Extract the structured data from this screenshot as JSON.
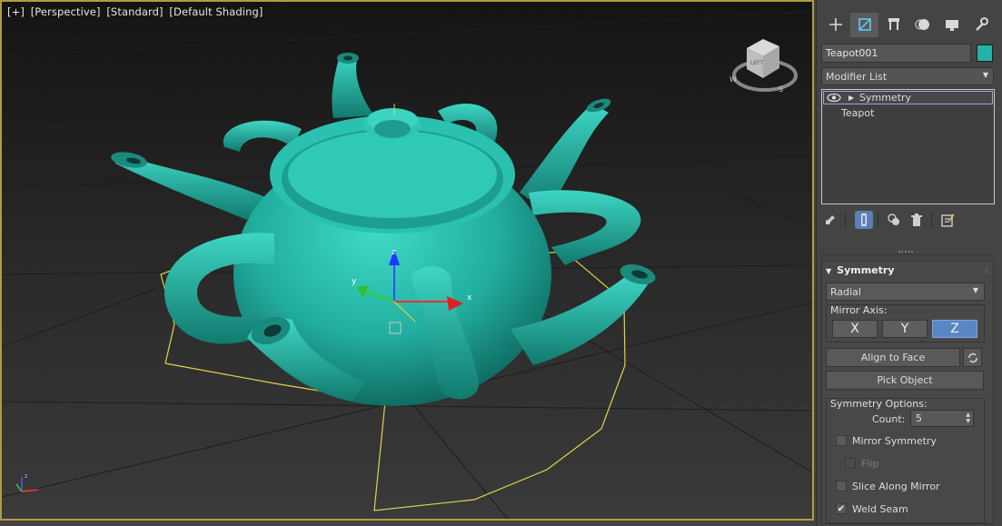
{
  "viewport": {
    "labels": [
      "[+]",
      "[Perspective]",
      "[Standard]",
      "[Default Shading]"
    ],
    "viewcube_face": "LEFT",
    "compass": {
      "w": "W",
      "s": "S"
    },
    "gizmo": {
      "x": "x",
      "y": "y",
      "z": "z"
    },
    "object_color": "#2ab6a4"
  },
  "command_panel": {
    "tabs": [
      {
        "name": "create-tab",
        "icon": "plus-icon"
      },
      {
        "name": "modify-tab",
        "icon": "modify-icon",
        "active": true
      },
      {
        "name": "hierarchy-tab",
        "icon": "hierarchy-icon"
      },
      {
        "name": "motion-tab",
        "icon": "motion-icon"
      },
      {
        "name": "display-tab",
        "icon": "display-icon"
      },
      {
        "name": "utilities-tab",
        "icon": "wrench-icon"
      }
    ],
    "object_name": "Teapot001",
    "object_color": "#23b3a7",
    "modifier_list": "Modifier List",
    "stack": {
      "items": [
        "Symmetry",
        "Teapot"
      ]
    },
    "rollout": {
      "title": "Symmetry",
      "mode": "Radial",
      "mirror_axis_label": "Mirror Axis:",
      "axes": [
        "X",
        "Y",
        "Z"
      ],
      "active_axis": "Z",
      "align_to_face": "Align to Face",
      "pick_object": "Pick Object",
      "options_label": "Symmetry Options:",
      "count_label": "Count:",
      "count_value": "5",
      "mirror_symmetry": {
        "label": "Mirror Symmetry",
        "checked": false
      },
      "flip": {
        "label": "Flip",
        "checked": false,
        "disabled": true
      },
      "slice_along_mirror": {
        "label": "Slice Along Mirror",
        "checked": false
      },
      "weld_seam": {
        "label": "Weld Seam",
        "checked": true
      }
    }
  }
}
